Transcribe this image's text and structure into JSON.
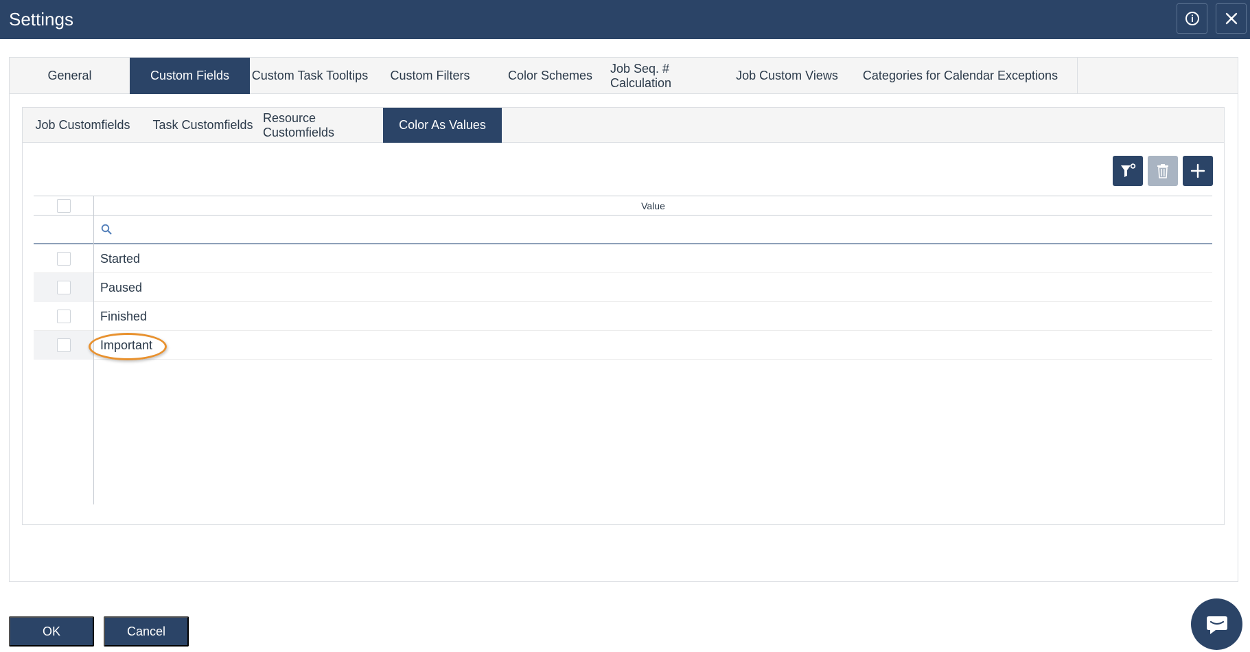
{
  "window": {
    "title": "Settings"
  },
  "tabs": [
    {
      "label": "General"
    },
    {
      "label": "Custom Fields"
    },
    {
      "label": "Custom Task Tooltips"
    },
    {
      "label": "Custom Filters"
    },
    {
      "label": "Color Schemes"
    },
    {
      "label": "Job Seq. # Calculation"
    },
    {
      "label": "Job Custom Views"
    },
    {
      "label": "Categories for Calendar Exceptions"
    }
  ],
  "active_tab": "Custom Fields",
  "subtabs": [
    {
      "label": "Job Customfields"
    },
    {
      "label": "Task Customfields"
    },
    {
      "label": "Resource Customfields"
    },
    {
      "label": "Color As Values"
    }
  ],
  "active_subtab": "Color As Values",
  "toolbar": {
    "icons": [
      "filter-clear-icon",
      "trash-icon",
      "plus-icon"
    ]
  },
  "grid": {
    "column_header": "Value",
    "filter_placeholder": "",
    "rows": [
      {
        "value": "Started"
      },
      {
        "value": "Paused"
      },
      {
        "value": "Finished"
      },
      {
        "value": "Important"
      }
    ]
  },
  "footer": {
    "ok_label": "OK",
    "cancel_label": "Cancel"
  },
  "colors": {
    "primary": "#2b4467",
    "highlight": "#e8912e",
    "disabled": "#a9b4c2"
  }
}
